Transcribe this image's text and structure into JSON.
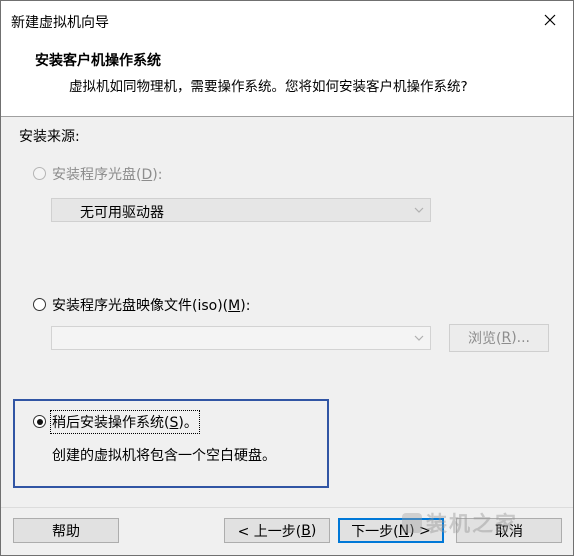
{
  "window": {
    "title": "新建虚拟机向导"
  },
  "header": {
    "title": "安装客户机操作系统",
    "subtitle": "虚拟机如同物理机，需要操作系统。您将如何安装客户机操作系统?"
  },
  "source_label": "安装来源:",
  "options": {
    "disc": {
      "label_prefix": "安装程序光盘(",
      "accel": "D",
      "label_suffix": "):",
      "selected": false,
      "enabled": false,
      "drive_value": "无可用驱动器"
    },
    "iso": {
      "label_prefix": "安装程序光盘映像文件(iso)(",
      "accel": "M",
      "label_suffix": "):",
      "selected": false,
      "enabled": true,
      "path_value": "",
      "browse_label_prefix": "浏览(",
      "browse_accel": "R",
      "browse_label_suffix": ")..."
    },
    "later": {
      "label_prefix": "稍后安装操作系统(",
      "accel": "S",
      "label_suffix": ")。",
      "selected": true,
      "description": "创建的虚拟机将包含一个空白硬盘。"
    }
  },
  "buttons": {
    "help": "帮助",
    "back_prefix": "< 上一步(",
    "back_accel": "B",
    "back_suffix": ")",
    "next_prefix": "下一步(",
    "next_accel": "N",
    "next_suffix": ") >",
    "cancel": "取消"
  },
  "watermark": "装机之家",
  "colors": {
    "highlight_box": "#3155a4",
    "primary_border": "#0078d7"
  }
}
